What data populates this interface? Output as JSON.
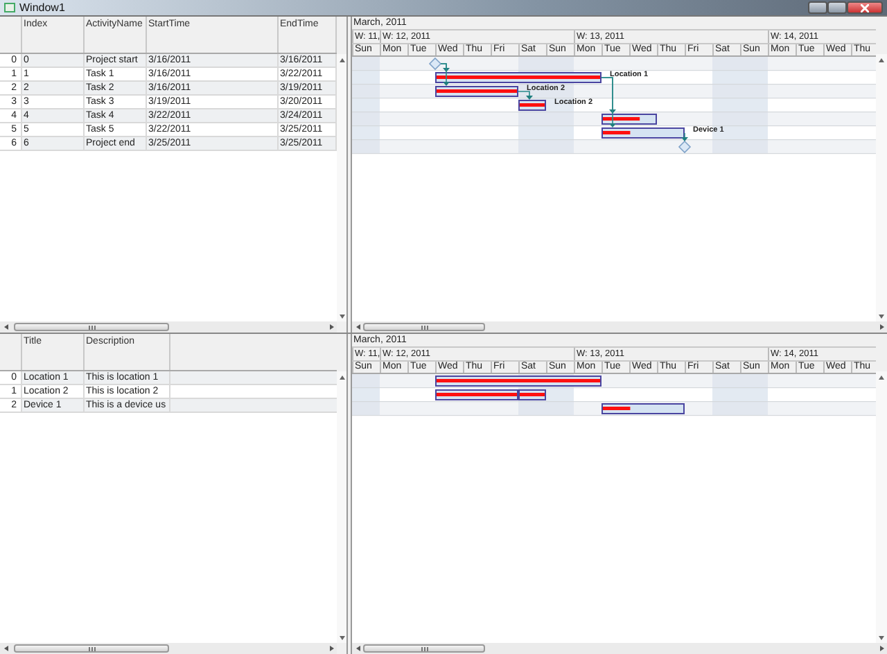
{
  "window": {
    "title": "Window1"
  },
  "tasks_grid": {
    "columns": [
      "Index",
      "ActivityName",
      "StartTime",
      "EndTime"
    ],
    "rows": [
      {
        "header": "0",
        "cells": [
          "0",
          "Project start",
          "3/16/2011",
          "3/16/2011"
        ]
      },
      {
        "header": "1",
        "cells": [
          "1",
          "Task 1",
          "3/16/2011",
          "3/22/2011"
        ]
      },
      {
        "header": "2",
        "cells": [
          "2",
          "Task 2",
          "3/16/2011",
          "3/19/2011"
        ]
      },
      {
        "header": "3",
        "cells": [
          "3",
          "Task 3",
          "3/19/2011",
          "3/20/2011"
        ]
      },
      {
        "header": "4",
        "cells": [
          "4",
          "Task 4",
          "3/22/2011",
          "3/24/2011"
        ]
      },
      {
        "header": "5",
        "cells": [
          "5",
          "Task 5",
          "3/22/2011",
          "3/25/2011"
        ]
      },
      {
        "header": "6",
        "cells": [
          "6",
          "Project end",
          "3/25/2011",
          "3/25/2011"
        ]
      }
    ]
  },
  "tasks_gantt": {
    "timeline": {
      "month": "March, 2011",
      "weeks": [
        {
          "label": "W: 11,",
          "days": [
            "Sun"
          ]
        },
        {
          "label": "W: 12, 2011",
          "days": [
            "Mon",
            "Tue",
            "Wed",
            "Thu",
            "Fri",
            "Sat",
            "Sun"
          ]
        },
        {
          "label": "W: 13, 2011",
          "days": [
            "Mon",
            "Tue",
            "Wed",
            "Thu",
            "Fri",
            "Sat",
            "Sun"
          ]
        },
        {
          "label": "W: 14, 2011",
          "days": [
            "Mon",
            "Tue",
            "Wed",
            "Thu"
          ]
        }
      ]
    },
    "bars": [
      {
        "kind": "milestone"
      },
      {
        "kind": "task",
        "level": 1,
        "label": "Location 1"
      },
      {
        "kind": "task",
        "level": 1,
        "label": "Location 2"
      },
      {
        "kind": "task",
        "level": 1,
        "label": "Location 2"
      },
      {
        "kind": "task",
        "level": 0.7
      },
      {
        "kind": "task",
        "level": 0.34,
        "label": "Device 1"
      },
      {
        "kind": "milestone"
      }
    ]
  },
  "resources_grid": {
    "columns": [
      "Title",
      "Description"
    ],
    "rows": [
      {
        "header": "0",
        "cells": [
          "Location 1",
          "This is location 1"
        ]
      },
      {
        "header": "1",
        "cells": [
          "Location 2",
          "This is location 2"
        ]
      },
      {
        "header": "2",
        "cells": [
          "Device 1",
          "This is a device us"
        ]
      }
    ]
  },
  "resources_gantt": {
    "timeline": {
      "month": "March, 2011",
      "weeks": [
        {
          "label": "W: 11,",
          "days": [
            "Sun"
          ]
        },
        {
          "label": "W: 12, 2011",
          "days": [
            "Mon",
            "Tue",
            "Wed",
            "Thu",
            "Fri",
            "Sat",
            "Sun"
          ]
        },
        {
          "label": "W: 13, 2011",
          "days": [
            "Mon",
            "Tue",
            "Wed",
            "Thu",
            "Fri",
            "Sat",
            "Sun"
          ]
        },
        {
          "label": "W: 14, 2011",
          "days": [
            "Mon",
            "Tue",
            "Wed",
            "Thu"
          ]
        }
      ]
    },
    "rows": [
      {
        "bars": [
          {
            "level": 1
          }
        ]
      },
      {
        "bars": [
          {
            "level": 1
          },
          {
            "level": 1
          }
        ]
      },
      {
        "bars": [
          {
            "level": 0.34
          }
        ]
      }
    ]
  }
}
